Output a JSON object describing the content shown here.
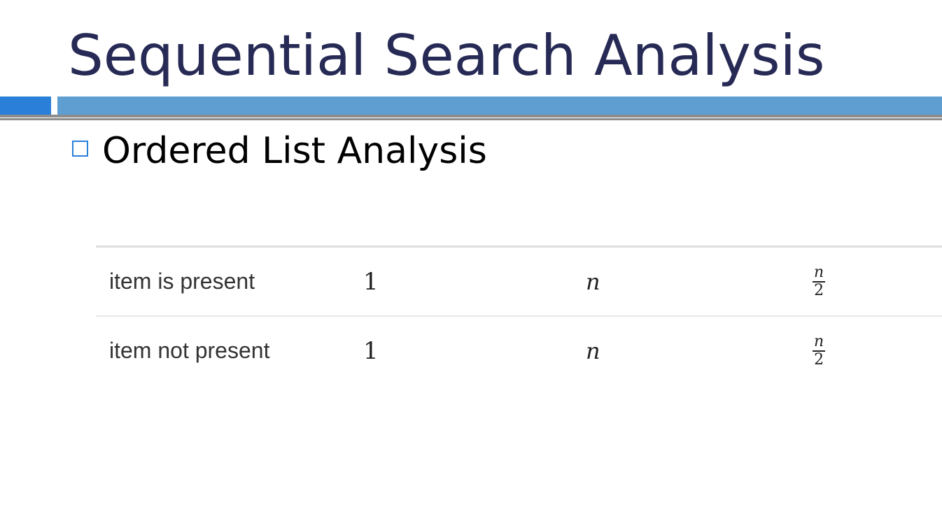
{
  "slide": {
    "title": "Sequential Search Analysis",
    "bullet": "Ordered List Analysis",
    "colors": {
      "title": "#262a55",
      "accent_bar": "#2a7fd8",
      "bar": "#5f9ed1"
    }
  },
  "table": {
    "rows": [
      {
        "case": "item is present",
        "best": "1",
        "worst": "n",
        "average": {
          "numerator": "n",
          "denominator": "2"
        }
      },
      {
        "case": "item not present",
        "best": "1",
        "worst": "n",
        "average": {
          "numerator": "n",
          "denominator": "2"
        }
      }
    ]
  }
}
